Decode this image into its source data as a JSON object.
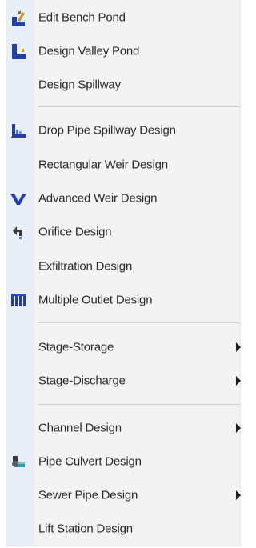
{
  "menu": {
    "items": [
      {
        "label": "Edit Bench Pond",
        "icon": "bench-pond-icon"
      },
      {
        "label": "Design Valley Pond",
        "icon": "valley-pond-icon"
      },
      {
        "label": "Design Spillway",
        "icon": ""
      },
      {
        "label": "Drop Pipe Spillway Design",
        "icon": "drop-pipe-icon"
      },
      {
        "label": "Rectangular Weir Design",
        "icon": ""
      },
      {
        "label": "Advanced Weir Design",
        "icon": "v-notch-weir-icon"
      },
      {
        "label": "Orifice Design",
        "icon": "orifice-icon"
      },
      {
        "label": "Exfiltration Design",
        "icon": ""
      },
      {
        "label": "Multiple Outlet Design",
        "icon": "multiple-outlet-icon"
      },
      {
        "label": "Stage-Storage",
        "icon": "",
        "submenu": true
      },
      {
        "label": "Stage-Discharge",
        "icon": "",
        "submenu": true
      },
      {
        "label": "Channel Design",
        "icon": "",
        "submenu": true
      },
      {
        "label": "Pipe Culvert Design",
        "icon": "pipe-culvert-icon"
      },
      {
        "label": "Sewer Pipe Design",
        "icon": "",
        "submenu": true
      },
      {
        "label": "Lift Station Design",
        "icon": ""
      }
    ]
  },
  "colors": {
    "menu_background": "#f3f3f3",
    "icon_gutter": "#e9edf5",
    "separator": "#cfcfcf",
    "icon_blue": "#1f3fb0",
    "icon_gold": "#c99a22"
  }
}
